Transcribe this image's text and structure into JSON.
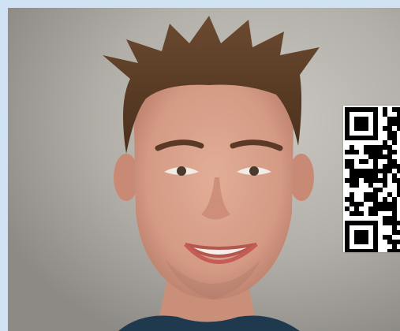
{
  "image": {
    "subject": "portrait-photo",
    "qr_code": "qr-code"
  },
  "colors": {
    "border": "#cfe2f3",
    "background": "#b3b0aa",
    "hair": "#5a3a22",
    "skin": "#d9a08a",
    "shirt": "#1f3a4f",
    "qr_dark": "#000000",
    "qr_light": "#ffffff"
  }
}
